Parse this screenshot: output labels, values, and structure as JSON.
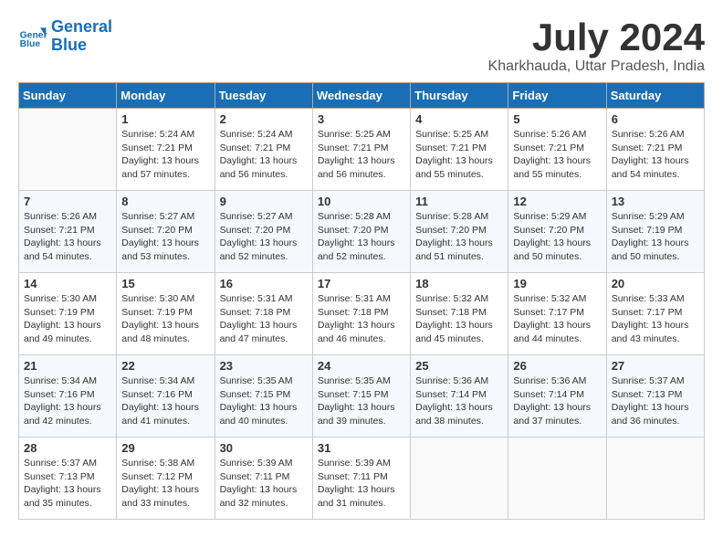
{
  "logo": {
    "line1": "General",
    "line2": "Blue"
  },
  "title": "July 2024",
  "location": "Kharkhauda, Uttar Pradesh, India",
  "headers": [
    "Sunday",
    "Monday",
    "Tuesday",
    "Wednesday",
    "Thursday",
    "Friday",
    "Saturday"
  ],
  "weeks": [
    [
      {
        "day": "",
        "info": ""
      },
      {
        "day": "1",
        "info": "Sunrise: 5:24 AM\nSunset: 7:21 PM\nDaylight: 13 hours\nand 57 minutes."
      },
      {
        "day": "2",
        "info": "Sunrise: 5:24 AM\nSunset: 7:21 PM\nDaylight: 13 hours\nand 56 minutes."
      },
      {
        "day": "3",
        "info": "Sunrise: 5:25 AM\nSunset: 7:21 PM\nDaylight: 13 hours\nand 56 minutes."
      },
      {
        "day": "4",
        "info": "Sunrise: 5:25 AM\nSunset: 7:21 PM\nDaylight: 13 hours\nand 55 minutes."
      },
      {
        "day": "5",
        "info": "Sunrise: 5:26 AM\nSunset: 7:21 PM\nDaylight: 13 hours\nand 55 minutes."
      },
      {
        "day": "6",
        "info": "Sunrise: 5:26 AM\nSunset: 7:21 PM\nDaylight: 13 hours\nand 54 minutes."
      }
    ],
    [
      {
        "day": "7",
        "info": "Sunrise: 5:26 AM\nSunset: 7:21 PM\nDaylight: 13 hours\nand 54 minutes."
      },
      {
        "day": "8",
        "info": "Sunrise: 5:27 AM\nSunset: 7:20 PM\nDaylight: 13 hours\nand 53 minutes."
      },
      {
        "day": "9",
        "info": "Sunrise: 5:27 AM\nSunset: 7:20 PM\nDaylight: 13 hours\nand 52 minutes."
      },
      {
        "day": "10",
        "info": "Sunrise: 5:28 AM\nSunset: 7:20 PM\nDaylight: 13 hours\nand 52 minutes."
      },
      {
        "day": "11",
        "info": "Sunrise: 5:28 AM\nSunset: 7:20 PM\nDaylight: 13 hours\nand 51 minutes."
      },
      {
        "day": "12",
        "info": "Sunrise: 5:29 AM\nSunset: 7:20 PM\nDaylight: 13 hours\nand 50 minutes."
      },
      {
        "day": "13",
        "info": "Sunrise: 5:29 AM\nSunset: 7:19 PM\nDaylight: 13 hours\nand 50 minutes."
      }
    ],
    [
      {
        "day": "14",
        "info": "Sunrise: 5:30 AM\nSunset: 7:19 PM\nDaylight: 13 hours\nand 49 minutes."
      },
      {
        "day": "15",
        "info": "Sunrise: 5:30 AM\nSunset: 7:19 PM\nDaylight: 13 hours\nand 48 minutes."
      },
      {
        "day": "16",
        "info": "Sunrise: 5:31 AM\nSunset: 7:18 PM\nDaylight: 13 hours\nand 47 minutes."
      },
      {
        "day": "17",
        "info": "Sunrise: 5:31 AM\nSunset: 7:18 PM\nDaylight: 13 hours\nand 46 minutes."
      },
      {
        "day": "18",
        "info": "Sunrise: 5:32 AM\nSunset: 7:18 PM\nDaylight: 13 hours\nand 45 minutes."
      },
      {
        "day": "19",
        "info": "Sunrise: 5:32 AM\nSunset: 7:17 PM\nDaylight: 13 hours\nand 44 minutes."
      },
      {
        "day": "20",
        "info": "Sunrise: 5:33 AM\nSunset: 7:17 PM\nDaylight: 13 hours\nand 43 minutes."
      }
    ],
    [
      {
        "day": "21",
        "info": "Sunrise: 5:34 AM\nSunset: 7:16 PM\nDaylight: 13 hours\nand 42 minutes."
      },
      {
        "day": "22",
        "info": "Sunrise: 5:34 AM\nSunset: 7:16 PM\nDaylight: 13 hours\nand 41 minutes."
      },
      {
        "day": "23",
        "info": "Sunrise: 5:35 AM\nSunset: 7:15 PM\nDaylight: 13 hours\nand 40 minutes."
      },
      {
        "day": "24",
        "info": "Sunrise: 5:35 AM\nSunset: 7:15 PM\nDaylight: 13 hours\nand 39 minutes."
      },
      {
        "day": "25",
        "info": "Sunrise: 5:36 AM\nSunset: 7:14 PM\nDaylight: 13 hours\nand 38 minutes."
      },
      {
        "day": "26",
        "info": "Sunrise: 5:36 AM\nSunset: 7:14 PM\nDaylight: 13 hours\nand 37 minutes."
      },
      {
        "day": "27",
        "info": "Sunrise: 5:37 AM\nSunset: 7:13 PM\nDaylight: 13 hours\nand 36 minutes."
      }
    ],
    [
      {
        "day": "28",
        "info": "Sunrise: 5:37 AM\nSunset: 7:13 PM\nDaylight: 13 hours\nand 35 minutes."
      },
      {
        "day": "29",
        "info": "Sunrise: 5:38 AM\nSunset: 7:12 PM\nDaylight: 13 hours\nand 33 minutes."
      },
      {
        "day": "30",
        "info": "Sunrise: 5:39 AM\nSunset: 7:11 PM\nDaylight: 13 hours\nand 32 minutes."
      },
      {
        "day": "31",
        "info": "Sunrise: 5:39 AM\nSunset: 7:11 PM\nDaylight: 13 hours\nand 31 minutes."
      },
      {
        "day": "",
        "info": ""
      },
      {
        "day": "",
        "info": ""
      },
      {
        "day": "",
        "info": ""
      }
    ]
  ]
}
